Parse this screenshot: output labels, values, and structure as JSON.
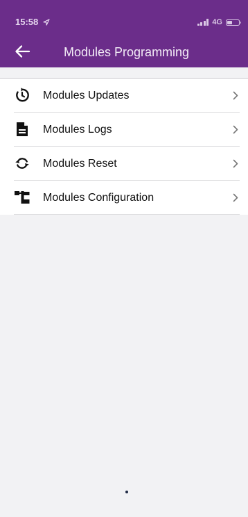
{
  "status_bar": {
    "time": "15:58",
    "network": "4G",
    "signal_bars": 4,
    "battery_level": 0.3,
    "icons": [
      "location-arrow-icon",
      "signal-icon",
      "battery-icon"
    ]
  },
  "nav": {
    "back_icon": "arrow-left-icon",
    "title": "Modules Programming"
  },
  "menu": {
    "items": [
      {
        "label": "Modules Updates",
        "icon": "history-clock-icon"
      },
      {
        "label": "Modules Logs",
        "icon": "document-icon"
      },
      {
        "label": "Modules Reset",
        "icon": "sync-icon"
      },
      {
        "label": "Modules Configuration",
        "icon": "hierarchy-icon"
      }
    ],
    "chevron_icon": "chevron-right-icon"
  },
  "colors": {
    "header": "#6b2d8a",
    "background": "#f2f2f4",
    "list_background": "#ffffff",
    "text": "#111111",
    "chevron": "#777777"
  }
}
